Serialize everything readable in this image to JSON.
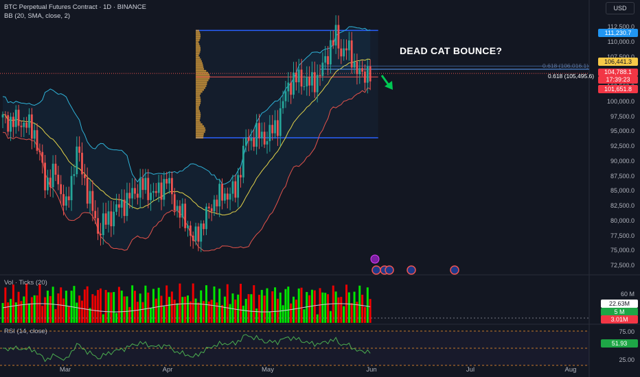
{
  "header": {
    "title": "BTC Perpetual Futures Contract · 1D · BINANCE",
    "indicator": "BB (20, SMA, close, 2)",
    "currency": "USD"
  },
  "annotation": "DEAD CAT BOUNCE?",
  "fib_label": "0.618 (105,495.6)",
  "fib_label_faint": "0.618 (106,016.1)",
  "price_axis": {
    "ticks": [
      "112,500.0",
      "110,000.0",
      "107,500.0",
      "102,500.0",
      "100,000.0",
      "97,500.0",
      "95,000.0",
      "92,500.0",
      "90,000.0",
      "87,500.0",
      "85,000.0",
      "82,500.0",
      "80,000.0",
      "77,500.0",
      "75,000.0",
      "72,500.0"
    ],
    "badges": {
      "upper_band": "111,230.7",
      "middle_band": "106,441.3",
      "last_price": "104,788.1",
      "countdown": "17:39:23",
      "lower_band": "101,651.8"
    }
  },
  "volume_pane": {
    "label": "Vol · Ticks (20)",
    "ticks": [
      "60 M",
      "5 M"
    ],
    "badges": {
      "ma": "22.63M",
      "vol_green": "5 M",
      "vol_red": "3.01M"
    }
  },
  "rsi_pane": {
    "label": "RSI (14, close)",
    "ticks": [
      "75.00",
      "25.00"
    ],
    "value": "51.93"
  },
  "time_axis": [
    "Mar",
    "Apr",
    "May",
    "Jun",
    "Jul",
    "Aug"
  ],
  "colors": {
    "up": "#26a69a",
    "down": "#ef5350",
    "vol_up": "#00e600",
    "vol_down": "#f00000",
    "bb_upper": "#2fb3d9",
    "bb_middle": "#e5d44a",
    "bb_lower": "#e5534b",
    "background": "#131722"
  },
  "chart_data": {
    "type": "candlestick",
    "symbol": "BTC Perpetual Futures Contract",
    "interval": "1D",
    "exchange": "BINANCE",
    "x_range": [
      "Feb",
      "Aug"
    ],
    "ylim": [
      72500,
      112500
    ],
    "anchors": [
      {
        "idx": 0,
        "close": 97000
      },
      {
        "idx": 8,
        "close": 96500
      },
      {
        "idx": 12,
        "close": 95000
      },
      {
        "idx": 16,
        "close": 86500
      },
      {
        "idx": 20,
        "close": 88000
      },
      {
        "idx": 24,
        "close": 82000
      },
      {
        "idx": 28,
        "close": 92000
      },
      {
        "idx": 32,
        "close": 85000
      },
      {
        "idx": 36,
        "close": 78500
      },
      {
        "idx": 42,
        "close": 81500
      },
      {
        "idx": 48,
        "close": 84000
      },
      {
        "idx": 52,
        "close": 86000
      },
      {
        "idx": 58,
        "close": 84500
      },
      {
        "idx": 62,
        "close": 87000
      },
      {
        "idx": 66,
        "close": 82000
      },
      {
        "idx": 70,
        "close": 79500
      },
      {
        "idx": 72,
        "close": 76500
      },
      {
        "idx": 76,
        "close": 80000
      },
      {
        "idx": 80,
        "close": 83500
      },
      {
        "idx": 84,
        "close": 84500
      },
      {
        "idx": 88,
        "close": 85000
      },
      {
        "idx": 92,
        "close": 93500
      },
      {
        "idx": 96,
        "close": 94500
      },
      {
        "idx": 100,
        "close": 94000
      },
      {
        "idx": 104,
        "close": 96500
      },
      {
        "idx": 108,
        "close": 103000
      },
      {
        "idx": 112,
        "close": 104000
      },
      {
        "idx": 116,
        "close": 103000
      },
      {
        "idx": 120,
        "close": 104500
      },
      {
        "idx": 124,
        "close": 109500
      },
      {
        "idx": 126,
        "close": 111000
      },
      {
        "idx": 128,
        "close": 108500
      },
      {
        "idx": 130,
        "close": 109000
      },
      {
        "idx": 132,
        "close": 107500
      },
      {
        "idx": 134,
        "close": 105500
      },
      {
        "idx": 136,
        "close": 104000
      },
      {
        "idx": 138,
        "close": 105500
      },
      {
        "idx": 139,
        "close": 104788
      }
    ],
    "bollinger": {
      "period": 20,
      "stddev": 2,
      "upper": 111230.7,
      "middle": 106441.3,
      "lower": 101651.8
    },
    "last_price": 104788.1,
    "fib_0618": 105495.6,
    "range_box": {
      "high": 112000,
      "low": 94000
    },
    "volume": {
      "ma": "22.63M"
    },
    "rsi": {
      "period": 14,
      "value": 51.93,
      "levels": [
        25,
        50,
        75
      ]
    }
  }
}
